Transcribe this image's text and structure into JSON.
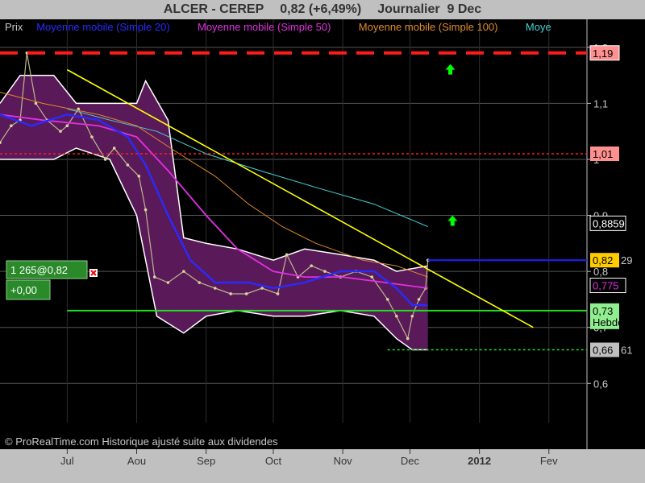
{
  "header": {
    "title": "ALCER - CEREP",
    "quote": "0,82 (+6,49%)",
    "period": "Journalier  9 Dec"
  },
  "legend": [
    {
      "label": "Prix",
      "color": "#c8c8c8"
    },
    {
      "label": "Moyenne mobile (Simple 20)",
      "color": "#2a2aff"
    },
    {
      "label": "Moyenne mobile (Simple 50)",
      "color": "#e030e0"
    },
    {
      "label": "Moyenne mobile (Simple 100)",
      "color": "#e08a2a"
    },
    {
      "label": "Moye",
      "color": "#48d0d0"
    }
  ],
  "order_box": {
    "line1": "1 265@0,82",
    "line2": "+0,00"
  },
  "copyright": "© ProRealTime.com Historique ajusté suite aux dividendes",
  "chart_data": {
    "type": "line",
    "ylim": [
      0.53,
      1.25
    ],
    "xlim": [
      "2011-06-01",
      "2012-02-18"
    ],
    "yticks": [
      {
        "value": 0.6,
        "label": "0,6"
      },
      {
        "value": 0.7,
        "label": "0,7"
      },
      {
        "value": 0.8,
        "label": "0,8"
      },
      {
        "value": 0.9,
        "label": "0,9"
      },
      {
        "value": 1.0,
        "label": "1"
      },
      {
        "value": 1.1,
        "label": "1,1"
      },
      {
        "value": 1.2,
        "label": "1,2"
      }
    ],
    "xticks": [
      {
        "date": "2011-07-01",
        "label": "Jul",
        "bold": false
      },
      {
        "date": "2011-08-01",
        "label": "Aou",
        "bold": false
      },
      {
        "date": "2011-09-01",
        "label": "Sep",
        "bold": false
      },
      {
        "date": "2011-10-01",
        "label": "Oct",
        "bold": false
      },
      {
        "date": "2011-11-01",
        "label": "Nov",
        "bold": false
      },
      {
        "date": "2011-12-01",
        "label": "Dec",
        "bold": false
      },
      {
        "date": "2012-01-01",
        "label": "2012",
        "bold": true
      },
      {
        "date": "2012-02-01",
        "label": "Fev",
        "bold": false
      }
    ],
    "price": [
      [
        "2011-06-01",
        1.03
      ],
      [
        "2011-06-06",
        1.06
      ],
      [
        "2011-06-10",
        1.07
      ],
      [
        "2011-06-13",
        1.19
      ],
      [
        "2011-06-17",
        1.1
      ],
      [
        "2011-06-22",
        1.07
      ],
      [
        "2011-06-28",
        1.05
      ],
      [
        "2011-07-01",
        1.06
      ],
      [
        "2011-07-06",
        1.09
      ],
      [
        "2011-07-12",
        1.04
      ],
      [
        "2011-07-18",
        1.0
      ],
      [
        "2011-07-22",
        1.02
      ],
      [
        "2011-07-28",
        0.99
      ],
      [
        "2011-08-02",
        0.97
      ],
      [
        "2011-08-05",
        0.91
      ],
      [
        "2011-08-09",
        0.79
      ],
      [
        "2011-08-15",
        0.78
      ],
      [
        "2011-08-22",
        0.8
      ],
      [
        "2011-08-29",
        0.78
      ],
      [
        "2011-09-05",
        0.77
      ],
      [
        "2011-09-12",
        0.76
      ],
      [
        "2011-09-19",
        0.76
      ],
      [
        "2011-09-26",
        0.77
      ],
      [
        "2011-10-03",
        0.76
      ],
      [
        "2011-10-07",
        0.83
      ],
      [
        "2011-10-12",
        0.79
      ],
      [
        "2011-10-18",
        0.81
      ],
      [
        "2011-10-24",
        0.8
      ],
      [
        "2011-10-31",
        0.79
      ],
      [
        "2011-11-07",
        0.8
      ],
      [
        "2011-11-14",
        0.79
      ],
      [
        "2011-11-21",
        0.75
      ],
      [
        "2011-11-25",
        0.72
      ],
      [
        "2011-11-30",
        0.68
      ],
      [
        "2011-12-02",
        0.72
      ],
      [
        "2011-12-05",
        0.75
      ],
      [
        "2011-12-08",
        0.77
      ],
      [
        "2011-12-09",
        0.82
      ]
    ],
    "sma20": [
      [
        "2011-06-01",
        1.08
      ],
      [
        "2011-06-15",
        1.06
      ],
      [
        "2011-07-01",
        1.08
      ],
      [
        "2011-07-15",
        1.07
      ],
      [
        "2011-07-28",
        1.04
      ],
      [
        "2011-08-05",
        0.99
      ],
      [
        "2011-08-15",
        0.9
      ],
      [
        "2011-08-25",
        0.82
      ],
      [
        "2011-09-05",
        0.78
      ],
      [
        "2011-09-20",
        0.78
      ],
      [
        "2011-10-01",
        0.77
      ],
      [
        "2011-10-15",
        0.78
      ],
      [
        "2011-10-31",
        0.8
      ],
      [
        "2011-11-15",
        0.8
      ],
      [
        "2011-11-25",
        0.77
      ],
      [
        "2011-12-02",
        0.74
      ],
      [
        "2011-12-09",
        0.74
      ]
    ],
    "sma50": [
      [
        "2011-06-01",
        1.08
      ],
      [
        "2011-06-20",
        1.07
      ],
      [
        "2011-07-15",
        1.06
      ],
      [
        "2011-08-01",
        1.04
      ],
      [
        "2011-08-15",
        0.98
      ],
      [
        "2011-09-01",
        0.9
      ],
      [
        "2011-09-15",
        0.84
      ],
      [
        "2011-10-01",
        0.8
      ],
      [
        "2011-10-15",
        0.79
      ],
      [
        "2011-11-01",
        0.79
      ],
      [
        "2011-11-20",
        0.78
      ],
      [
        "2011-12-09",
        0.77
      ]
    ],
    "sma100": [
      [
        "2011-06-01",
        1.12
      ],
      [
        "2011-06-20",
        1.1
      ],
      [
        "2011-07-15",
        1.08
      ],
      [
        "2011-08-01",
        1.06
      ],
      [
        "2011-08-20",
        1.01
      ],
      [
        "2011-09-05",
        0.97
      ],
      [
        "2011-09-20",
        0.92
      ],
      [
        "2011-10-05",
        0.88
      ],
      [
        "2011-10-20",
        0.85
      ],
      [
        "2011-11-10",
        0.82
      ],
      [
        "2011-11-25",
        0.81
      ],
      [
        "2011-12-09",
        0.79
      ]
    ],
    "sma200": [
      [
        "2011-07-01",
        1.09
      ],
      [
        "2011-07-20",
        1.07
      ],
      [
        "2011-08-10",
        1.05
      ],
      [
        "2011-09-01",
        1.01
      ],
      [
        "2011-09-25",
        0.98
      ],
      [
        "2011-10-20",
        0.95
      ],
      [
        "2011-11-15",
        0.92
      ],
      [
        "2011-12-09",
        0.88
      ]
    ],
    "bollinger_upper": [
      [
        "2011-06-01",
        1.1
      ],
      [
        "2011-06-10",
        1.15
      ],
      [
        "2011-06-25",
        1.15
      ],
      [
        "2011-07-05",
        1.1
      ],
      [
        "2011-07-20",
        1.1
      ],
      [
        "2011-08-01",
        1.1
      ],
      [
        "2011-08-05",
        1.14
      ],
      [
        "2011-08-15",
        1.07
      ],
      [
        "2011-08-22",
        0.86
      ],
      [
        "2011-09-01",
        0.85
      ],
      [
        "2011-09-15",
        0.84
      ],
      [
        "2011-10-01",
        0.82
      ],
      [
        "2011-10-15",
        0.84
      ],
      [
        "2011-10-31",
        0.83
      ],
      [
        "2011-11-15",
        0.82
      ],
      [
        "2011-11-25",
        0.8
      ],
      [
        "2011-12-09",
        0.81
      ]
    ],
    "bollinger_lower": [
      [
        "2011-06-01",
        1.0
      ],
      [
        "2011-06-10",
        1.0
      ],
      [
        "2011-06-25",
        1.0
      ],
      [
        "2011-07-05",
        1.02
      ],
      [
        "2011-07-20",
        1.0
      ],
      [
        "2011-08-01",
        0.9
      ],
      [
        "2011-08-10",
        0.72
      ],
      [
        "2011-08-22",
        0.69
      ],
      [
        "2011-09-01",
        0.72
      ],
      [
        "2011-09-15",
        0.73
      ],
      [
        "2011-10-01",
        0.72
      ],
      [
        "2011-10-15",
        0.72
      ],
      [
        "2011-10-31",
        0.73
      ],
      [
        "2011-11-15",
        0.72
      ],
      [
        "2011-11-25",
        0.68
      ],
      [
        "2011-12-02",
        0.66
      ],
      [
        "2011-12-09",
        0.66
      ]
    ],
    "trendline": {
      "from": [
        "2011-07-01",
        1.16
      ],
      "to": [
        "2012-01-25",
        0.7
      ],
      "color": "#ffff00"
    },
    "hlines": [
      {
        "value": 1.19,
        "color": "#ff1a1a",
        "style": "dashed-thick"
      },
      {
        "value": 1.01,
        "color": "#ff1a1a",
        "style": "dotted"
      },
      {
        "value": 0.73,
        "color": "#22dd22",
        "style": "solid",
        "from": "2011-07-01"
      },
      {
        "value": 0.82,
        "color": "#2020ff",
        "style": "solid",
        "from": "2011-12-09"
      },
      {
        "value": 0.66,
        "color": "#22dd22",
        "style": "dotted",
        "from": "2011-11-21"
      }
    ],
    "arrows": [
      {
        "date": "2011-12-19",
        "value": 1.16,
        "color": "#00ff00"
      },
      {
        "date": "2011-12-20",
        "value": 0.89,
        "color": "#00ff00"
      }
    ],
    "price_tags": [
      {
        "value": 1.19,
        "text": "1,19",
        "bg": "#ff9090",
        "fg": "#000000",
        "border": "#ffffff"
      },
      {
        "value": 1.01,
        "text": "1,01",
        "bg": "#ff9090",
        "fg": "#000000",
        "border": "none"
      },
      {
        "value": 0.8859,
        "text": "0,8859",
        "bg": "#000000",
        "fg": "#ffffff",
        "border": "#ffffff"
      },
      {
        "value": 0.82,
        "text": "0,82",
        "suffix": "29",
        "bg": "#ffcc00",
        "fg": "#000000",
        "border": "none"
      },
      {
        "value": 0.775,
        "text": "0,775",
        "bg": "#000000",
        "fg": "#e030e0",
        "border": "#ffffff"
      },
      {
        "value": 0.73,
        "text": "0,73",
        "line2": "Hebdo",
        "bg": "#90ee90",
        "fg": "#000000",
        "border": "none"
      },
      {
        "value": 0.66,
        "text": "0,66",
        "suffix": "61",
        "bg": "#c0c0c0",
        "fg": "#000000",
        "border": "none"
      }
    ]
  }
}
